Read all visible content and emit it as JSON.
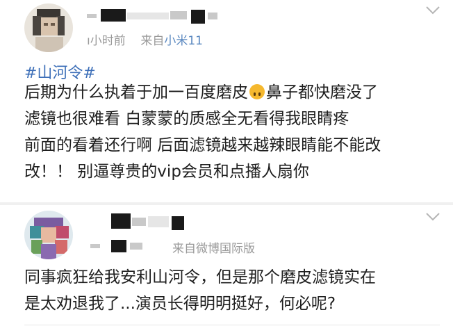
{
  "posts": [
    {
      "meta_time": "ı小时前",
      "meta_from": "来自",
      "meta_source": "小米11",
      "topic": "#山河令#",
      "lines": [
        "后期为什么执着于加一百度磨皮",
        "鼻子都快磨没了",
        "滤镜也很难看 白蒙蒙的质感全无看得我眼睛疼",
        "前面的看着还行啊 后面滤镜越来越辣眼睛能不能改",
        "改！！ 别逼尊贵的vip会员和点播人扇你"
      ],
      "emoji_icon": "upside-down-face-emoji"
    },
    {
      "meta_source": "来自微博国际版",
      "lines": [
        "同事疯狂给我安利山河令，但是那个磨皮滤镜实在",
        "是太劝退我了...演员长得明明挺好，何必呢?"
      ]
    }
  ],
  "icons": [
    "avatar",
    "chevron-down-icon"
  ],
  "colors": {
    "link": "#3d6fb8",
    "source": "#5a88c0",
    "meta": "#9a9a9a",
    "text": "#1e1e1e"
  }
}
